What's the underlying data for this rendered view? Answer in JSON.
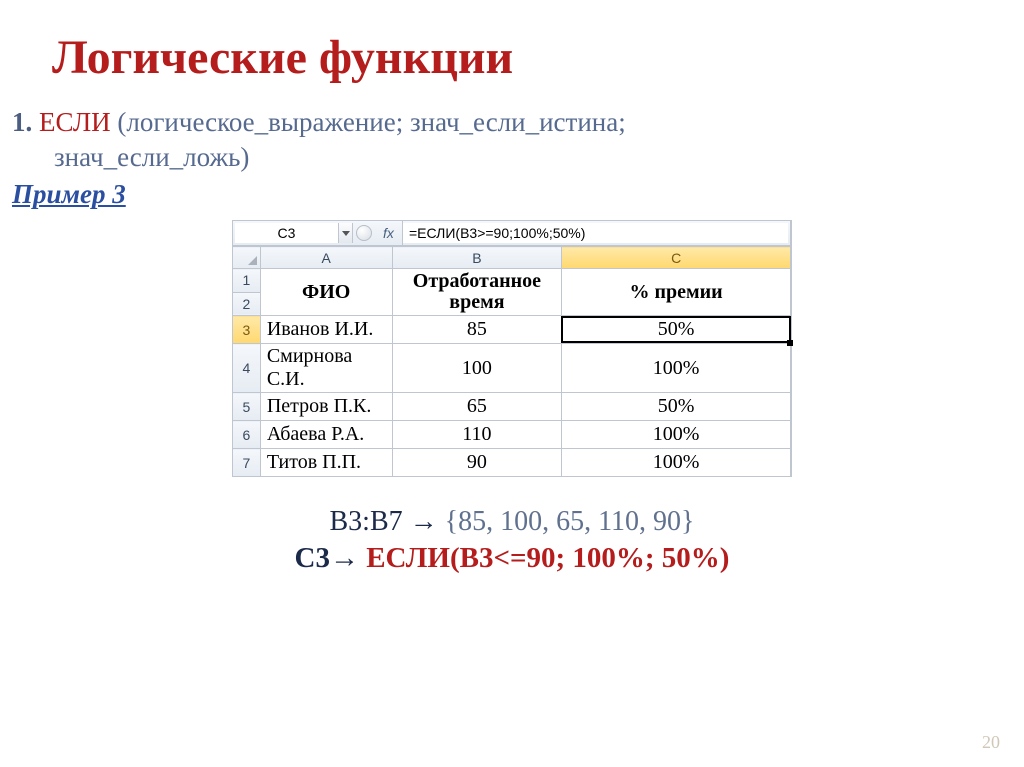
{
  "title": "Логические функции",
  "syntax": {
    "num": "1.",
    "fn": "ЕСЛИ",
    "rest1": " (логическое_выражение; знач_если_истина;",
    "rest2": "знач_если_ложь)"
  },
  "example_label": "Пример 3",
  "ss": {
    "namebox": "C3",
    "fx_label": "fx",
    "formula": "=ЕСЛИ(B3>=90;100%;50%)",
    "cols": [
      "A",
      "B",
      "C"
    ],
    "headers": {
      "A": "ФИО",
      "B": "Отработанное время",
      "C": "% премии"
    },
    "rows": [
      {
        "r": "3",
        "a": "Иванов И.И.",
        "b": "85",
        "c": "50%"
      },
      {
        "r": "4",
        "a": "Смирнова С.И.",
        "b": "100",
        "c": "100%"
      },
      {
        "r": "5",
        "a": "Петров П.К.",
        "b": "65",
        "c": "50%"
      },
      {
        "r": "6",
        "a": "Абаева Р.А.",
        "b": "110",
        "c": "100%"
      },
      {
        "r": "7",
        "a": "Титов П.П.",
        "b": "90",
        "c": "100%"
      }
    ],
    "header_row_nums": [
      "1",
      "2"
    ]
  },
  "bottom": {
    "range": "B3:B7 ",
    "arrow": "→",
    "vals": " {85, 100, 65, 110, 90}",
    "ref": "C3",
    "arrow2": "→ ",
    "fn": "ЕСЛИ(B3<=90; 100%; 50%)"
  },
  "pagenum": "20"
}
